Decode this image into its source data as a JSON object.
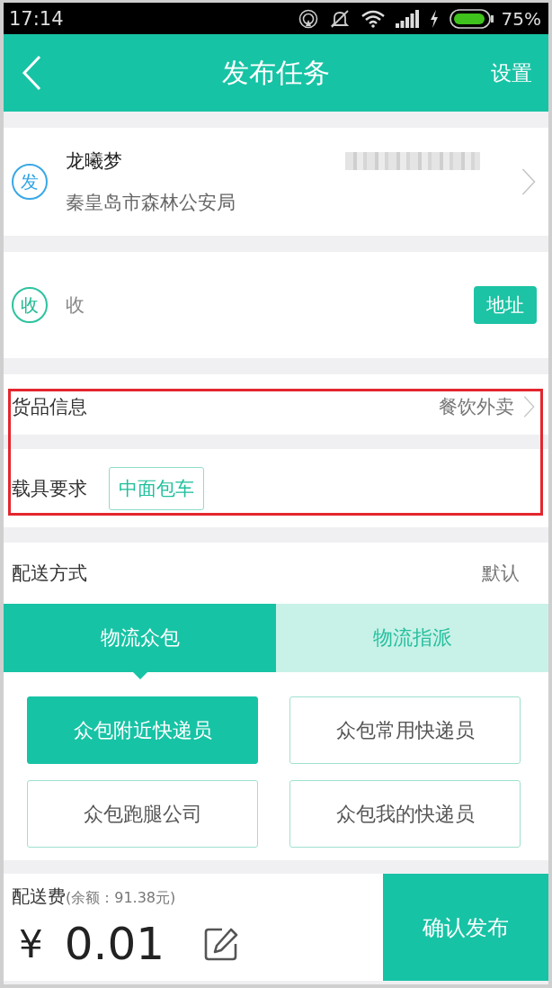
{
  "status_bar": {
    "time": "17:14",
    "battery": "75%"
  },
  "header": {
    "title": "发布任务",
    "action": "设置"
  },
  "sender": {
    "badge": "发",
    "name": "龙曦梦",
    "address": "秦皇岛市森林公安局"
  },
  "receiver": {
    "badge": "收",
    "text": "收",
    "button": "地址"
  },
  "cargo": {
    "highlighted": true,
    "goods_label": "货品信息",
    "goods_value": "餐饮外卖",
    "vehicle_label": "载具要求",
    "vehicle_tag": "中面包车"
  },
  "delivery": {
    "label": "配送方式",
    "value": "默认",
    "tabs": [
      {
        "label": "物流众包",
        "selected": true
      },
      {
        "label": "物流指派",
        "selected": false
      }
    ],
    "options": [
      {
        "label": "众包附近快递员",
        "selected": true
      },
      {
        "label": "众包常用快递员",
        "selected": false
      },
      {
        "label": "众包跑腿公司",
        "selected": false
      },
      {
        "label": "众包我的快递员",
        "selected": false
      }
    ]
  },
  "footer": {
    "fee_label": "配送费",
    "balance": "(余额：91.38元)",
    "currency": "¥",
    "amount": "0.01",
    "confirm": "确认发布"
  }
}
